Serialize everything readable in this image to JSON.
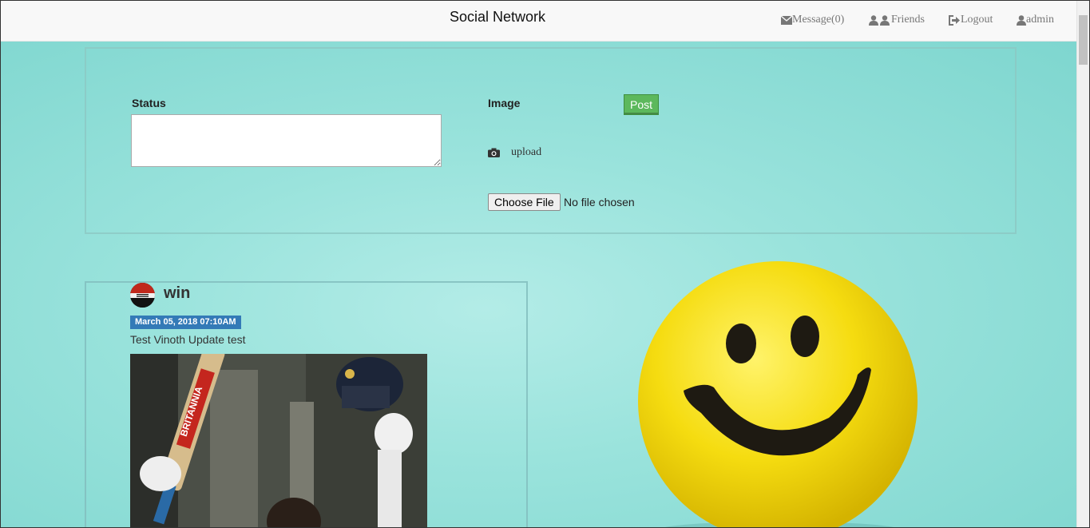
{
  "navbar": {
    "brand": "Social Network",
    "items": [
      {
        "label": "Message(0)",
        "icon": "envelope-icon"
      },
      {
        "label": "Friends",
        "icon": "users-icon"
      },
      {
        "label": "Logout",
        "icon": "logout-icon"
      },
      {
        "label": "admin",
        "icon": "user-icon"
      }
    ]
  },
  "post_form": {
    "status_label": "Status",
    "status_value": "",
    "image_label": "Image",
    "post_button": "Post",
    "upload_label": "upload",
    "file_button": "Choose File",
    "file_status": "No file chosen"
  },
  "feed": {
    "posts": [
      {
        "username": "win",
        "date": "March 05, 2018 07:10AM",
        "text": "Test Vinoth Update test",
        "image_brand_text": "BRITANNIA"
      }
    ]
  },
  "colors": {
    "background": "#8fdcd5",
    "post_button": "#5cb85c",
    "date_badge": "#337ab7"
  }
}
